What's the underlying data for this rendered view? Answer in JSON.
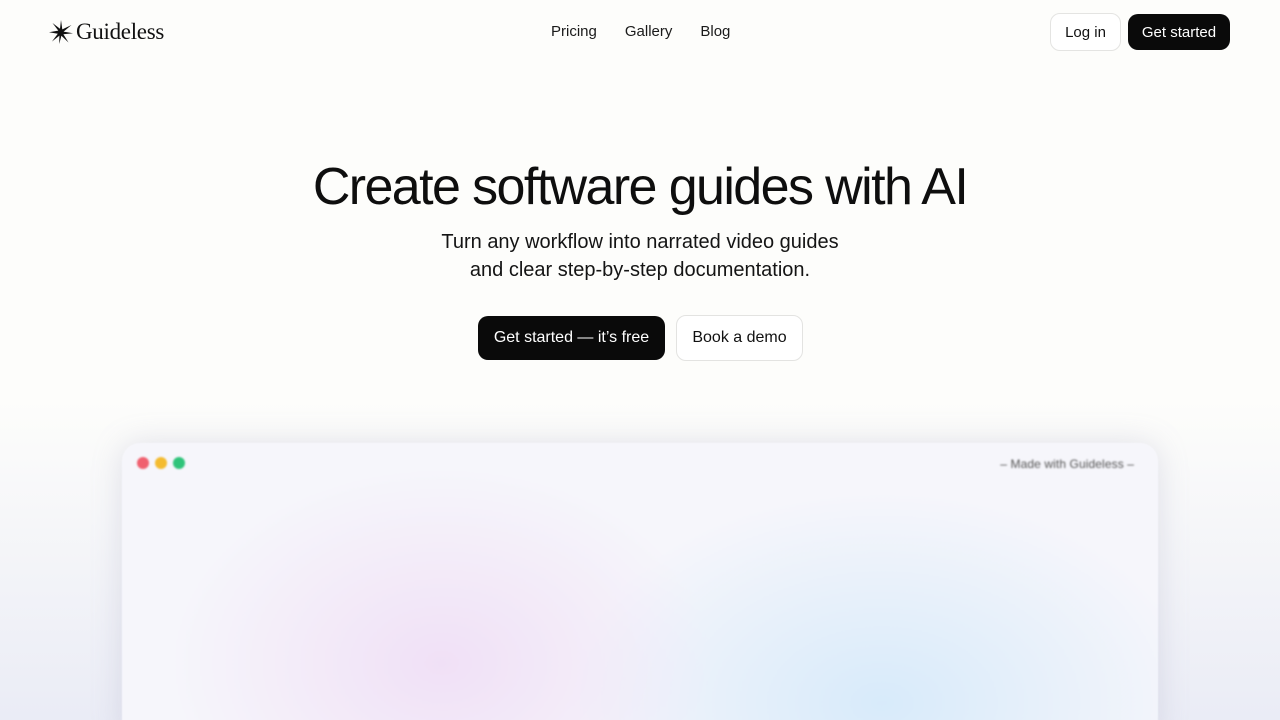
{
  "brand": {
    "name": "Guideless",
    "logo_icon": "sparkle-star-icon"
  },
  "nav": {
    "items": [
      {
        "label": "Pricing"
      },
      {
        "label": "Gallery"
      },
      {
        "label": "Blog"
      }
    ]
  },
  "header_actions": {
    "login_label": "Log in",
    "get_started_label": "Get started"
  },
  "hero": {
    "title": "Create software guides with AI",
    "subtitle_line1": "Turn any workflow into narrated video guides",
    "subtitle_line2": "and clear step-by-step documentation.",
    "cta_primary": "Get started — it’s free",
    "cta_secondary": "Book a demo"
  },
  "preview": {
    "badge": "– Made with Guideless –",
    "window_controls": [
      "close-dot",
      "minimize-dot",
      "maximize-dot"
    ]
  },
  "colors": {
    "background": "#fdfdfb",
    "primary_button": "#0a0a0a",
    "dot_red": "#f0606f",
    "dot_yellow": "#f4bb2f",
    "dot_green": "#2fc47a"
  }
}
